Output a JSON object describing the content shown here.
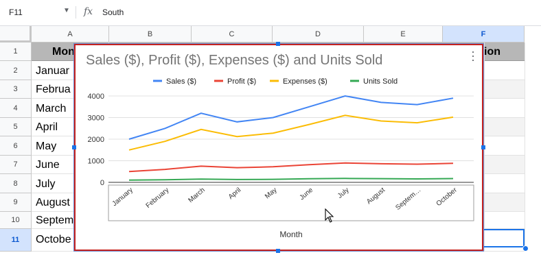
{
  "formula_bar": {
    "name_box": "F11",
    "fx_symbol": "fx",
    "value": "South",
    "caret": "▼"
  },
  "columns": [
    "A",
    "B",
    "C",
    "D",
    "E",
    "F"
  ],
  "selected_column": "F",
  "rows": [
    "1",
    "2",
    "3",
    "4",
    "5",
    "6",
    "7",
    "8",
    "9",
    "10",
    "11"
  ],
  "selected_row": "11",
  "sheet": {
    "header_A": "Mon",
    "header_F": "ion",
    "col_A_values": [
      "Januar",
      "Februa",
      "March",
      "April",
      "May",
      "June",
      "July",
      "August",
      "Septem",
      "Octobe"
    ]
  },
  "chart_data": {
    "type": "line",
    "title": "Sales ($), Profit ($), Expenses ($) and Units Sold",
    "xlabel": "Month",
    "ylabel": "",
    "ylim": [
      0,
      4000
    ],
    "yticks": [
      "0",
      "1000",
      "2000",
      "3000",
      "4000"
    ],
    "categories": [
      "January",
      "February",
      "March",
      "April",
      "May",
      "June",
      "July",
      "August",
      "Septem…",
      "October"
    ],
    "legend_position": "top",
    "grid": true,
    "series": [
      {
        "name": "Sales ($)",
        "color": "#4285f4",
        "values": [
          2000,
          2500,
          3200,
          2800,
          3000,
          3500,
          4000,
          3700,
          3600,
          3900
        ]
      },
      {
        "name": "Profit ($)",
        "color": "#ea4335",
        "values": [
          500,
          600,
          750,
          680,
          720,
          820,
          900,
          860,
          840,
          880
        ]
      },
      {
        "name": "Expenses ($)",
        "color": "#fbbc04",
        "values": [
          1500,
          1900,
          2450,
          2120,
          2280,
          2680,
          3100,
          2840,
          2760,
          3020
        ]
      },
      {
        "name": "Units Sold",
        "color": "#34a853",
        "values": [
          100,
          120,
          150,
          130,
          140,
          165,
          180,
          170,
          160,
          175
        ]
      }
    ]
  },
  "colors": {
    "selection_blue": "#1a73e8",
    "chart_border_red": "#c5221f",
    "header_gray": "#b7b7b7"
  },
  "icons": [
    "dropdown-caret-icon",
    "fx-icon",
    "more-vert-icon",
    "mouse-cursor-icon"
  ]
}
